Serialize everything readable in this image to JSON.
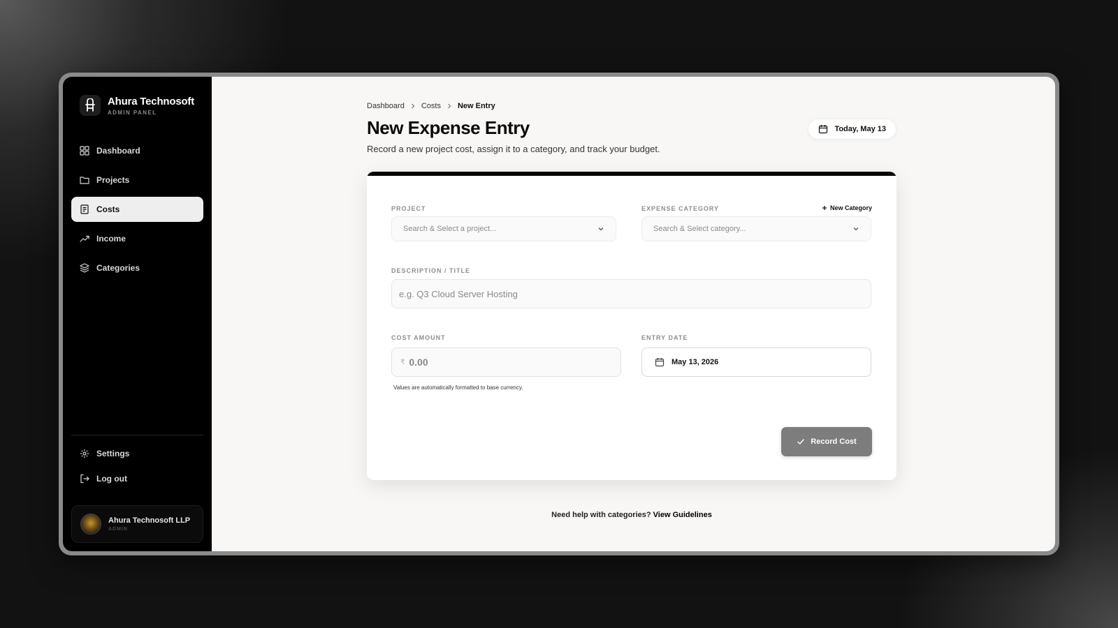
{
  "sidebar": {
    "brand_name": "Ahura Technosoft",
    "brand_sub": "ADMIN PANEL",
    "items": [
      {
        "label": "Dashboard",
        "icon": "grid-icon"
      },
      {
        "label": "Projects",
        "icon": "folder-icon"
      },
      {
        "label": "Costs",
        "icon": "receipt-icon",
        "active": true
      },
      {
        "label": "Income",
        "icon": "trending-up-icon"
      },
      {
        "label": "Categories",
        "icon": "layers-icon"
      }
    ],
    "bottom_items": [
      {
        "label": "Settings",
        "icon": "gear-icon"
      },
      {
        "label": "Log out",
        "icon": "logout-icon"
      }
    ],
    "user": {
      "name": "Ahura Technosoft LLP",
      "role": "ADMIN"
    }
  },
  "breadcrumb": {
    "items": [
      "Dashboard",
      "Costs"
    ],
    "current": "New Entry"
  },
  "page": {
    "title": "New Expense Entry",
    "subtitle": "Record a new project cost, assign it to a category, and track your budget.",
    "date_pill": "Today, May 13"
  },
  "form": {
    "project_label": "PROJECT",
    "project_placeholder": "Search & Select a project...",
    "category_label": "EXPENSE CATEGORY",
    "new_category": "New Category",
    "category_placeholder": "Search & Select category...",
    "description_label": "DESCRIPTION / TITLE",
    "description_placeholder": "e.g. Q3 Cloud Server Hosting",
    "amount_label": "COST AMOUNT",
    "currency_symbol": "₹",
    "amount_placeholder": "0.00",
    "amount_hint": "Values are automatically formatted to base currency.",
    "date_label": "ENTRY DATE",
    "date_value": "May 13, 2026",
    "submit_label": "Record Cost"
  },
  "help": {
    "text": "Need help with categories?",
    "link": "View Guidelines"
  },
  "colors": {
    "accent": "#000000",
    "active_nav_bg": "#eeeeee",
    "button_bg": "#7d7d7d"
  }
}
